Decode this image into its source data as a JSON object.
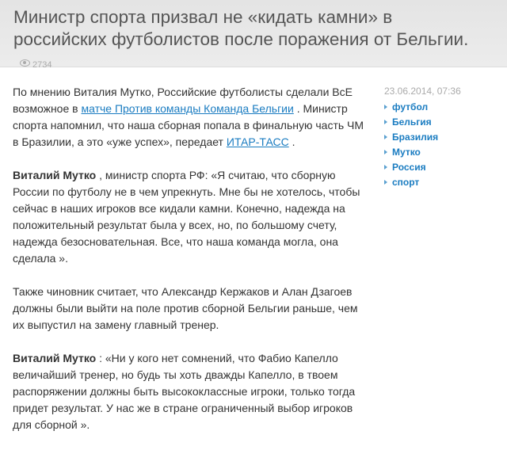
{
  "header": {
    "title": "Министр спорта призвал не «кидать камни» в российских футболистов после поражения от Бельгии.",
    "views": "2734",
    "views_icon": "eye-icon"
  },
  "meta": {
    "date": "23.06.2014, 07:36"
  },
  "tags": [
    "футбол",
    "Бельгия",
    "Бразилия",
    "Мутко",
    "Россия",
    "спорт"
  ],
  "article": {
    "p1_a": "По мнению Виталия Мутко, Российские футболисты сделали ВсЕ возможное в ",
    "p1_link1": "матче Против команды Команда Бельгии",
    "p1_b": " . Министр спорта напомнил, что наша сборная попала в финальную часть ЧМ в Бразилии, а это «уже успех», передает ",
    "p1_link2": "ИТАР-ТАСС",
    "p1_c": " .",
    "p2_author": "Виталий Мутко",
    "p2_text": " , министр спорта РФ: «Я считаю, что сборную России по футболу не в чем упрекнуть. Мне бы не хотелось, чтобы сейчас в наших игроков все кидали камни. Конечно, надежда на положительный результат была у всех, но, по большому счету, надежда безосновательная. Все, что наша команда могла, она сделала ».",
    "p3_text": "Также чиновник считает, что Александр Кержаков и Алан Дзагоев должны были выйти на поле против сборной Бельгии раньше, чем их выпустил на замену главный тренер.",
    "p4_author": "Виталий Мутко",
    "p4_text": " : «Ни у кого нет сомнений, что Фабио Капелло величайший тренер, но будь ты хоть дважды Капелло, в твоем распоряжении должны быть высококлассные игроки, только тогда придет результат. У нас же в стране ограниченный выбор игроков для сборной »."
  }
}
